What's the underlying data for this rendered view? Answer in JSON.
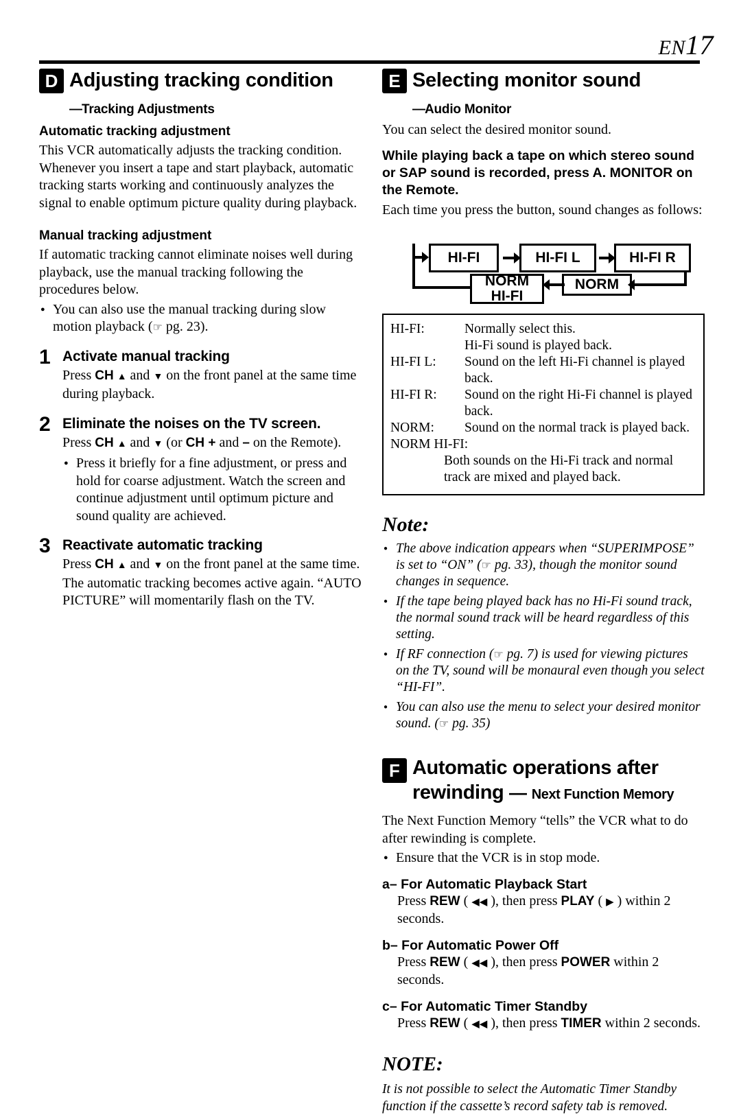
{
  "header": {
    "en": "EN",
    "page": "17"
  },
  "sectionD": {
    "badge": "D",
    "title": "Adjusting tracking condition",
    "subtitle": "Tracking Adjustments",
    "sub1_head": "Automatic tracking adjustment",
    "sub1_body": "This VCR automatically adjusts the tracking condition. Whenever you insert a tape and start playback, automatic tracking starts working and continuously analyzes the signal to enable optimum picture quality during playback.",
    "sub2_head": "Manual tracking adjustment",
    "sub2_body": "If automatic tracking cannot eliminate noises well during playback, use the manual tracking following the procedures below.",
    "sub2_bullet": "You can also use the manual tracking during slow motion playback ( pg. 23).",
    "steps": [
      {
        "num": "1",
        "title": "Activate manual tracking",
        "body_pre": "Press ",
        "body_ch": "CH",
        "body_mid": " and ",
        "body_post": " on the front panel at the same time during playback."
      },
      {
        "num": "2",
        "title": "Eliminate the noises on the TV screen.",
        "body_pre": "Press ",
        "body_ch": "CH",
        "body_mid": " and ",
        "body_or": "(or ",
        "body_chplus": "CH +",
        "body_and2": " and ",
        "body_minus": "–",
        "body_post": " on the Remote).",
        "bullet": "Press it briefly for a fine adjustment, or press and hold for coarse adjustment. Watch the screen and continue adjustment until optimum picture and sound quality are achieved."
      },
      {
        "num": "3",
        "title": "Reactivate automatic tracking",
        "body_pre": "Press ",
        "body_ch": "CH",
        "body_mid": " and ",
        "body_post": " on the front panel at the same time. The automatic tracking becomes active again. “AUTO PICTURE” will momentarily flash on the TV."
      }
    ]
  },
  "sectionE": {
    "badge": "E",
    "title": "Selecting monitor sound",
    "subtitle": "Audio Monitor",
    "body1": "You can select the desired monitor sound.",
    "bold_para": "While playing back a tape on which stereo sound or SAP sound is recorded, press A. MONITOR on the Remote.",
    "body2": "Each time you press the button, sound changes as follows:",
    "flow": {
      "box1": "HI-FI",
      "box2": "HI-FI L",
      "box3": "HI-FI R",
      "box4_line1": "NORM",
      "box4_line2": "HI-FI",
      "box5": "NORM"
    },
    "table": [
      {
        "label": "HI-FI:",
        "value": "Normally select this."
      },
      {
        "label": "",
        "value": "Hi-Fi sound is played back.",
        "indent": true
      },
      {
        "label": "HI-FI L:",
        "value": "Sound on the left Hi-Fi channel is played back."
      },
      {
        "label": "HI-FI R:",
        "value": "Sound on the right Hi-Fi channel is played back."
      },
      {
        "label": "NORM:",
        "value": "Sound on the normal track is played back."
      },
      {
        "label": "NORM  HI-FI:",
        "value": ""
      },
      {
        "label": "",
        "value": "Both sounds on the Hi-Fi track and normal track are mixed and played back.",
        "indent": true
      }
    ],
    "note_head": "Note:",
    "notes": [
      "The above indication appears when “SUPERIMPOSE” is set to “ON” ( pg. 33), though the monitor sound changes in sequence.",
      "If the tape being played back has no Hi-Fi sound track, the normal sound track will be heard regardless of this setting.",
      "If RF connection ( pg. 7) is used for viewing pictures on the TV, sound will be monaural even though you select “HI-FI”.",
      "You can also use the menu to select your desired monitor sound. ( pg. 35)"
    ]
  },
  "sectionF": {
    "badge": "F",
    "title_line1": "Automatic operations after",
    "title_line2": "rewinding",
    "title_sub": "Next Function Memory",
    "body1": "The Next Function Memory “tells” the VCR what to do after rewinding is complete.",
    "bullet": "Ensure that the VCR is in stop mode.",
    "items": [
      {
        "label": "a– For Automatic Playback Start",
        "pre": "Press ",
        "rew": "REW",
        "mid": " ), then press ",
        "key": "PLAY",
        "post": " ) within 2 seconds."
      },
      {
        "label": "b– For Automatic Power Off",
        "pre": "Press ",
        "rew": "REW",
        "mid": " ), then press ",
        "key": "POWER",
        "post": " within 2 seconds."
      },
      {
        "label": "c– For Automatic Timer Standby",
        "pre": "Press ",
        "rew": "REW",
        "mid": " ), then press ",
        "key": "TIMER",
        "post": " within 2 seconds."
      }
    ],
    "note_head": "NOTE:",
    "note_body": "It is not possible to select the Automatic Timer Standby function if the cassette’s record safety tab is removed."
  }
}
